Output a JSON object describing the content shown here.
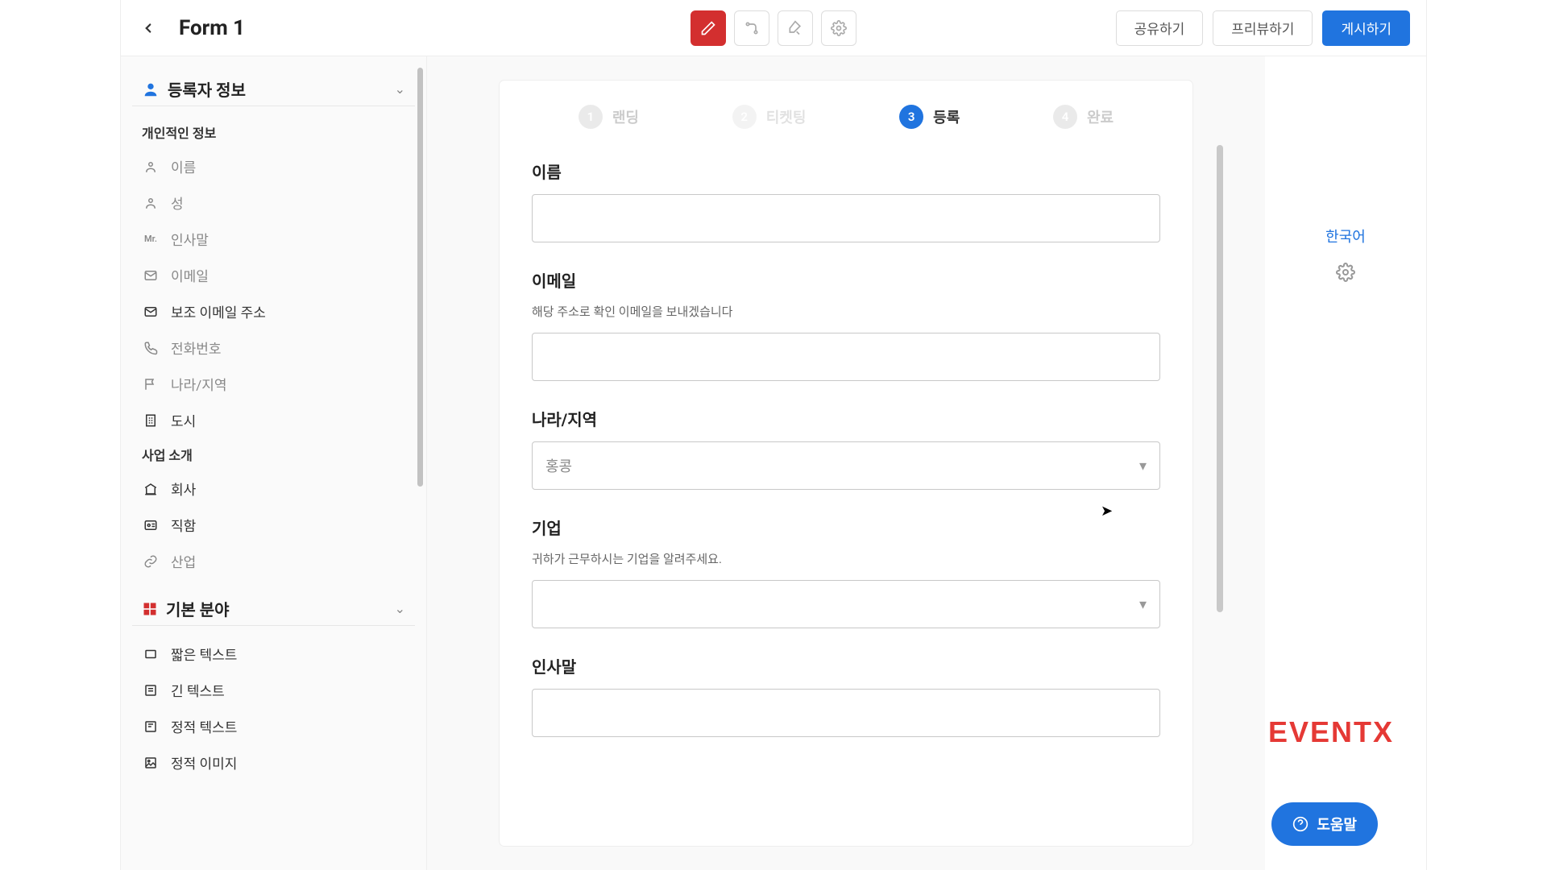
{
  "header": {
    "form_title": "Form 1",
    "buttons": {
      "share": "공유하기",
      "preview": "프리뷰하기",
      "publish": "게시하기"
    }
  },
  "sidebar": {
    "section1_title": "등록자 정보",
    "sub_personal": "개인적인 정보",
    "items_personal": {
      "first_name": "이름",
      "last_name": "성",
      "salutation": "인사말",
      "salutation_badge": "Mr.",
      "email": "이메일",
      "secondary_email": "보조 이메일 주소",
      "phone": "전화번호",
      "country": "나라/지역",
      "city": "도시"
    },
    "sub_business": "사업 소개",
    "items_business": {
      "company": "회사",
      "title": "직함",
      "industry": "산업"
    },
    "section2_title": "기본 분야",
    "items_basic": {
      "short_text": "짧은 텍스트",
      "long_text": "긴 텍스트",
      "static_text": "정적 텍스트",
      "static_image": "정적 이미지"
    }
  },
  "steps": {
    "s1_num": "1",
    "s1_label": "랜딩",
    "s2_num": "2",
    "s2_label": "티켓팅",
    "s3_num": "3",
    "s3_label": "등록",
    "s4_num": "4",
    "s4_label": "완료"
  },
  "form": {
    "name_label": "이름",
    "email_label": "이메일",
    "email_hint": "해당 주소로 확인 이메일을 보내겠습니다",
    "country_label": "나라/지역",
    "country_value": "홍콩",
    "company_label": "기업",
    "company_hint": "귀하가 근무하시는 기업을 알려주세요.",
    "salutation_label": "인사말"
  },
  "rail": {
    "language": "한국어"
  },
  "brand": "EVENTX",
  "help": "도움말"
}
